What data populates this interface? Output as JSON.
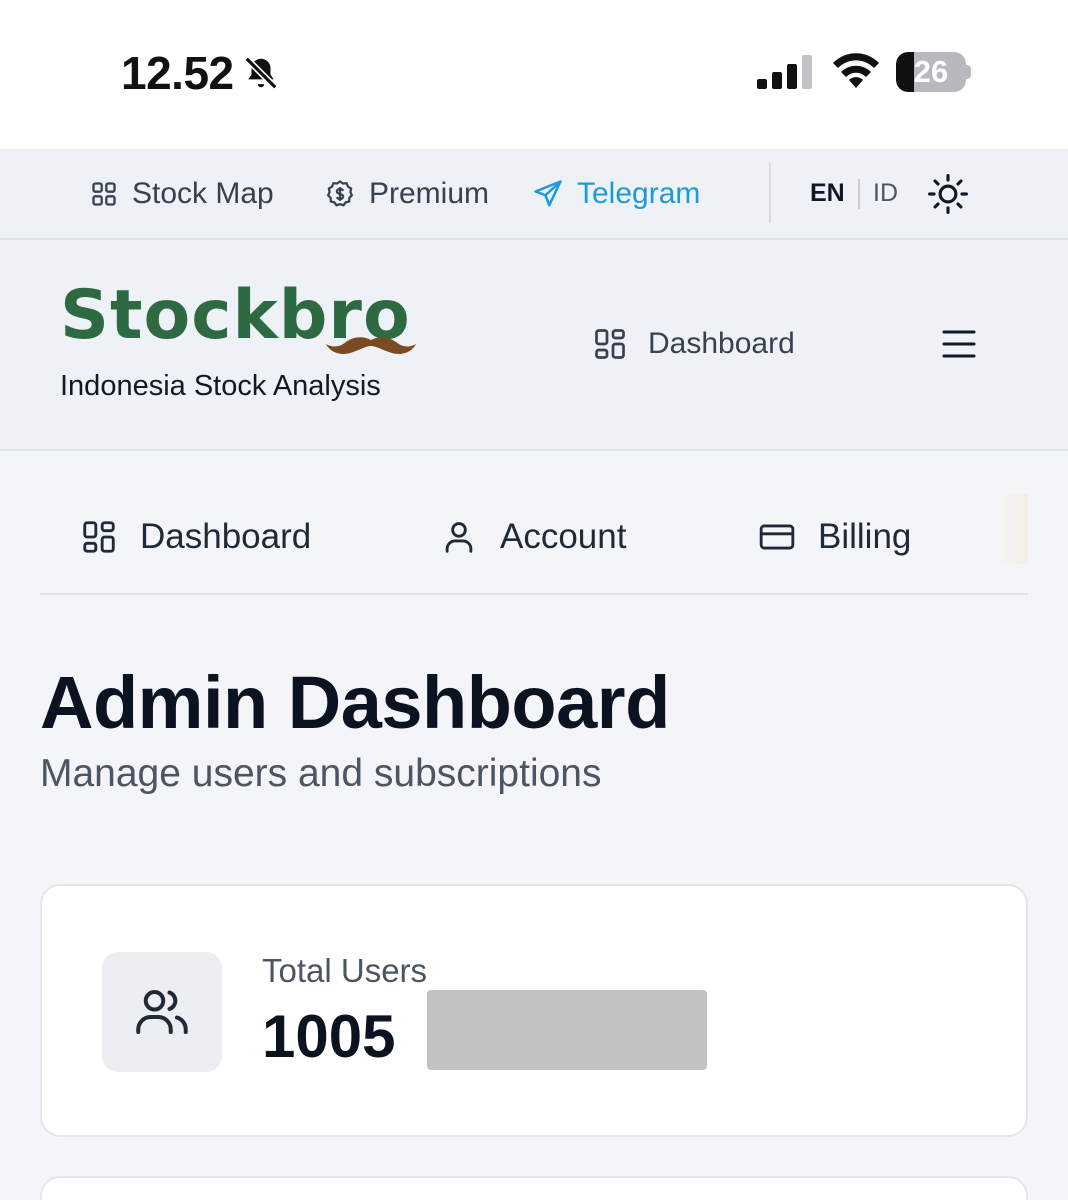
{
  "status_bar": {
    "time": "12.52",
    "battery": "26",
    "battery_level": 0.26,
    "icons": [
      "bell-slash-icon",
      "cellular-signal-icon",
      "wifi-icon",
      "battery-icon"
    ]
  },
  "top_bar": {
    "links": [
      {
        "label": "Stock Map",
        "icon": "grid-icon"
      },
      {
        "label": "Premium",
        "icon": "dollar-badge-icon"
      },
      {
        "label": "Telegram",
        "icon": "paper-plane-icon"
      }
    ],
    "languages": [
      "EN",
      "ID"
    ],
    "active_language": "EN",
    "theme_icon": "sun-icon"
  },
  "header": {
    "logo_text": "Stockbro",
    "tagline": "Indonesia Stock Analysis",
    "nav_label": "Dashboard",
    "menu_icon": "hamburger-menu-icon"
  },
  "tabs": [
    {
      "label": "Dashboard",
      "icon": "grid-icon"
    },
    {
      "label": "Account",
      "icon": "user-icon"
    },
    {
      "label": "Billing",
      "icon": "credit-card-icon"
    }
  ],
  "page": {
    "title": "Admin Dashboard",
    "subtitle": "Manage users and subscriptions"
  },
  "stats": [
    {
      "label": "Total Users",
      "value": "1005",
      "icon": "users-icon"
    }
  ],
  "colors": {
    "brand_green": "#2d6a42",
    "telegram_blue": "#1c9bd6",
    "background": "#f3f5f8"
  }
}
